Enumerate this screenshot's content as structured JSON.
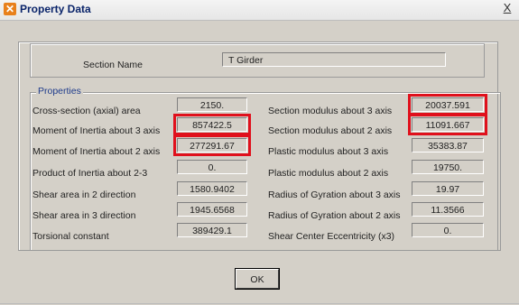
{
  "window": {
    "title": "Property Data",
    "close_label": "X"
  },
  "section_name": {
    "label": "Section Name",
    "value": "T Girder"
  },
  "properties": {
    "group_label": "Properties",
    "left": [
      {
        "label": "Cross-section (axial) area",
        "value": "2150."
      },
      {
        "label": "Moment of Inertia about 3 axis",
        "value": "857422.5"
      },
      {
        "label": "Moment of Inertia about 2 axis",
        "value": "277291.67"
      },
      {
        "label": "Product of Inertia about 2-3",
        "value": "0."
      },
      {
        "label": "Shear area in 2 direction",
        "value": "1580.9402"
      },
      {
        "label": "Shear area in 3 direction",
        "value": "1945.6568"
      },
      {
        "label": "Torsional constant",
        "value": "389429.1"
      }
    ],
    "right": [
      {
        "label": "Section modulus about 3 axis",
        "value": "20037.591"
      },
      {
        "label": "Section modulus about 2 axis",
        "value": "11091.667"
      },
      {
        "label": "Plastic modulus about 3 axis",
        "value": "35383.87"
      },
      {
        "label": "Plastic modulus about 2 axis",
        "value": "19750."
      },
      {
        "label": "Radius of Gyration about 3 axis",
        "value": "19.97"
      },
      {
        "label": "Radius of Gyration about 2 axis",
        "value": "11.3566"
      },
      {
        "label": "Shear Center Eccentricity (x3)",
        "value": "0."
      }
    ]
  },
  "buttons": {
    "ok": "OK"
  },
  "colors": {
    "highlight": "#e0101c",
    "title_text": "#0a246a",
    "group_label": "#1f3c8c"
  }
}
